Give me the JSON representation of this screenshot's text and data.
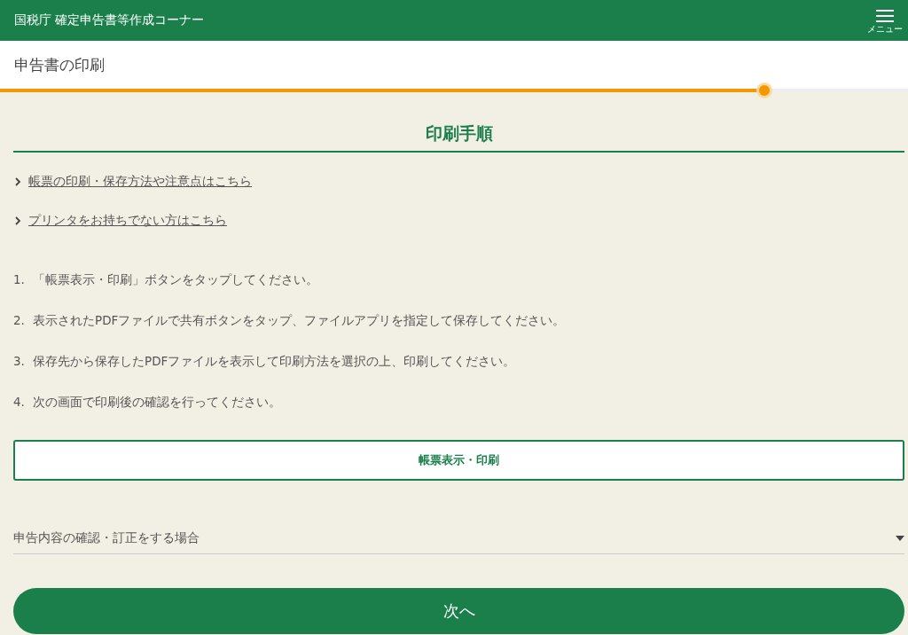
{
  "header": {
    "title": "国税庁 確定申告書等作成コーナー",
    "menu_label": "メニュー"
  },
  "page_title": "申告書の印刷",
  "progress": {
    "level": 0.842
  },
  "section_heading": "印刷手順",
  "links": [
    "帳票の印刷・保存方法や注意点はこちら",
    "プリンタをお持ちでない方はこちら"
  ],
  "steps": [
    {
      "number": "1.",
      "text": "「帳票表示・印刷」ボタンをタップしてください。"
    },
    {
      "number": "2.",
      "text": "表示されたPDFファイルで共有ボタンをタップ、ファイルアプリを指定して保存してください。"
    },
    {
      "number": "3.",
      "text": "保存先から保存したPDFファイルを表示して印刷方法を選択の上、印刷してください。"
    },
    {
      "number": "4.",
      "text": "次の画面で印刷後の確認を行ってください。"
    }
  ],
  "print_button": "帳票表示・印刷",
  "accordion": {
    "label": "申告内容の確認・訂正をする場合",
    "expanded": false
  },
  "next_button": "次へ"
}
